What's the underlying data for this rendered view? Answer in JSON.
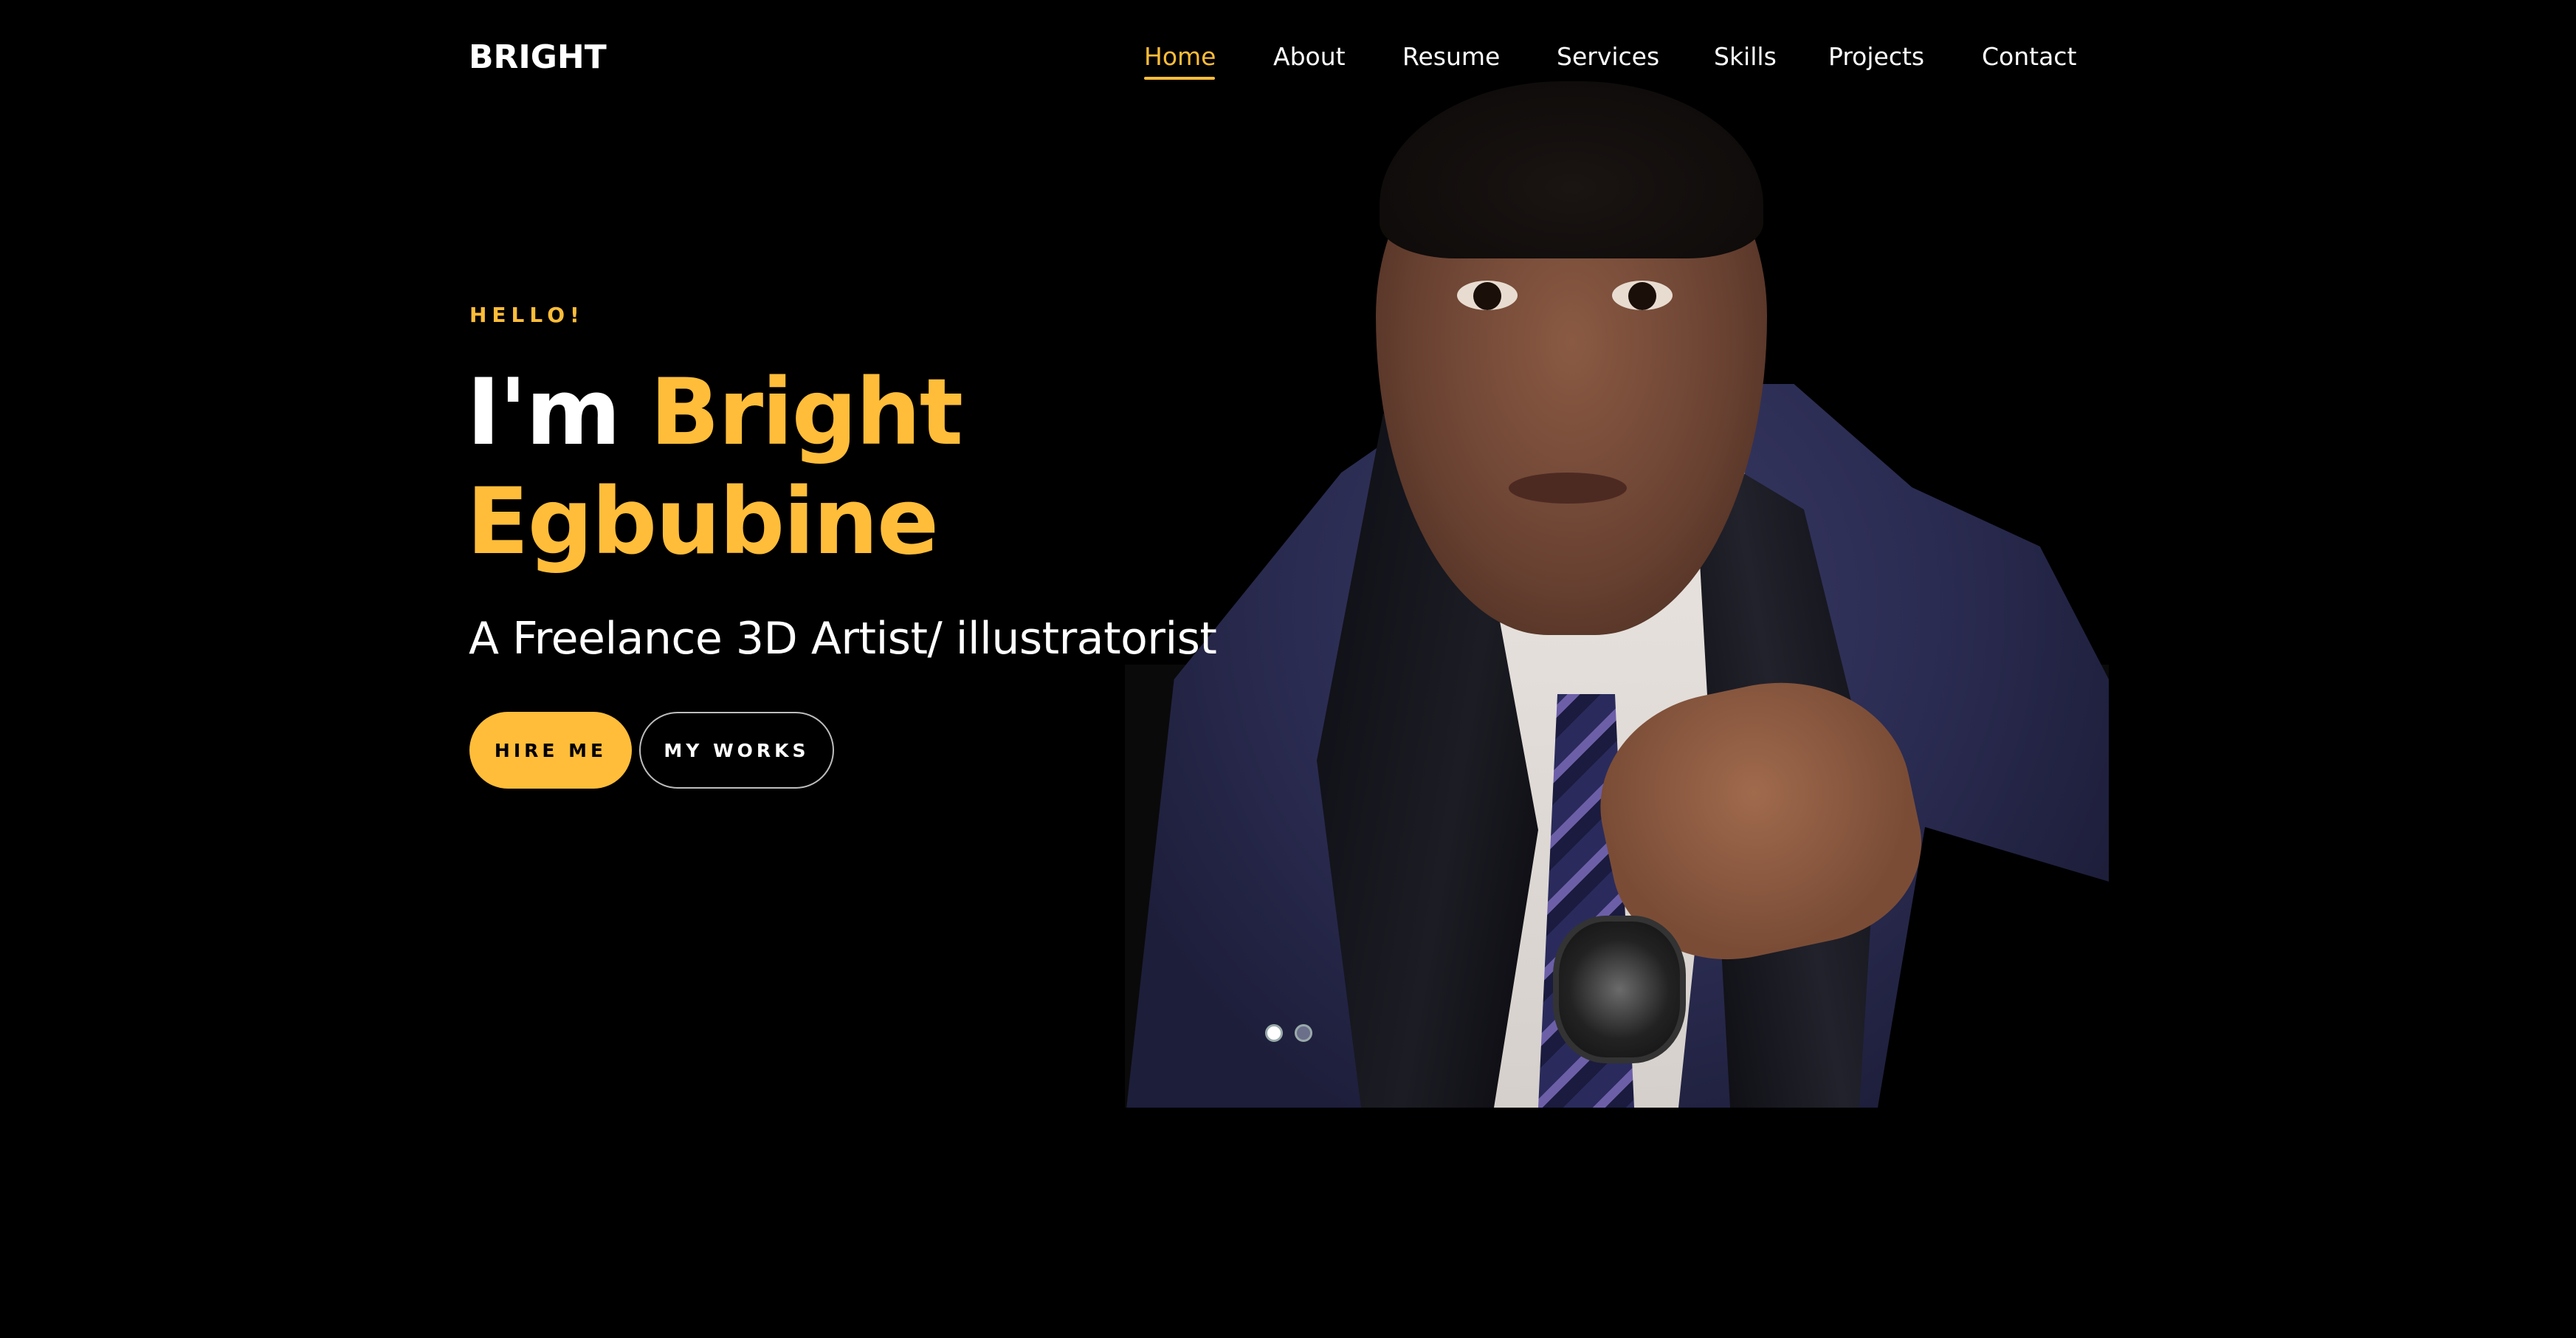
{
  "header": {
    "logo": "BRIGHT",
    "nav": [
      {
        "label": "Home",
        "active": true
      },
      {
        "label": "About"
      },
      {
        "label": "Resume"
      },
      {
        "label": "Services"
      },
      {
        "label": "Skills"
      },
      {
        "label": "Projects"
      },
      {
        "label": "Contact"
      }
    ]
  },
  "hero": {
    "greeting": "HELLO!",
    "title_prefix": "I'm",
    "title_name_line1": "Bright",
    "title_name_line2": "Egbubine",
    "subtitle": "A Freelance 3D Artist/ illustratorist",
    "buttons": {
      "hire": "HIRE ME",
      "works": "MY WORKS"
    },
    "slider": {
      "count": 2,
      "active_index": 0
    }
  },
  "colors": {
    "background": "#000000",
    "accent": "#ffbd39",
    "text": "#ffffff"
  }
}
